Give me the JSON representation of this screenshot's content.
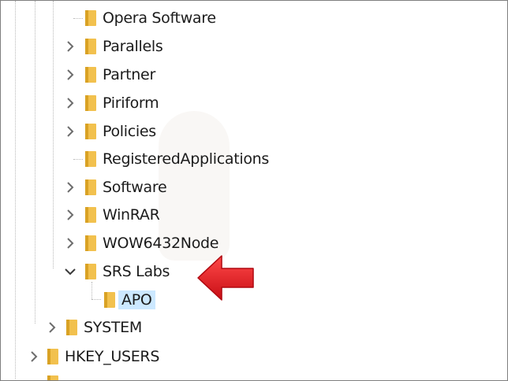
{
  "tree": {
    "items": [
      {
        "label": "Opera Software",
        "expandable": false
      },
      {
        "label": "Parallels",
        "expandable": true,
        "expanded": false
      },
      {
        "label": "Partner",
        "expandable": true,
        "expanded": false
      },
      {
        "label": "Piriform",
        "expandable": true,
        "expanded": false
      },
      {
        "label": "Policies",
        "expandable": true,
        "expanded": false
      },
      {
        "label": "RegisteredApplications",
        "expandable": false
      },
      {
        "label": "Software",
        "expandable": true,
        "expanded": false
      },
      {
        "label": "WinRAR",
        "expandable": true,
        "expanded": false
      },
      {
        "label": "WOW6432Node",
        "expandable": true,
        "expanded": false
      },
      {
        "label": "SRS Labs",
        "expandable": true,
        "expanded": true
      },
      {
        "label": "APO",
        "expandable": false,
        "selected": true
      },
      {
        "label": "SYSTEM",
        "expandable": true,
        "expanded": false
      },
      {
        "label": "HKEY_USERS",
        "expandable": true,
        "expanded": false
      }
    ]
  },
  "annotation": {
    "icon": "red-arrow-icon",
    "color": "#e8141b"
  },
  "colors": {
    "folder": "#f2c14e",
    "folder_dark": "#d9a225",
    "selection": "#cce8ff",
    "chevron": "#6d6d6d"
  }
}
